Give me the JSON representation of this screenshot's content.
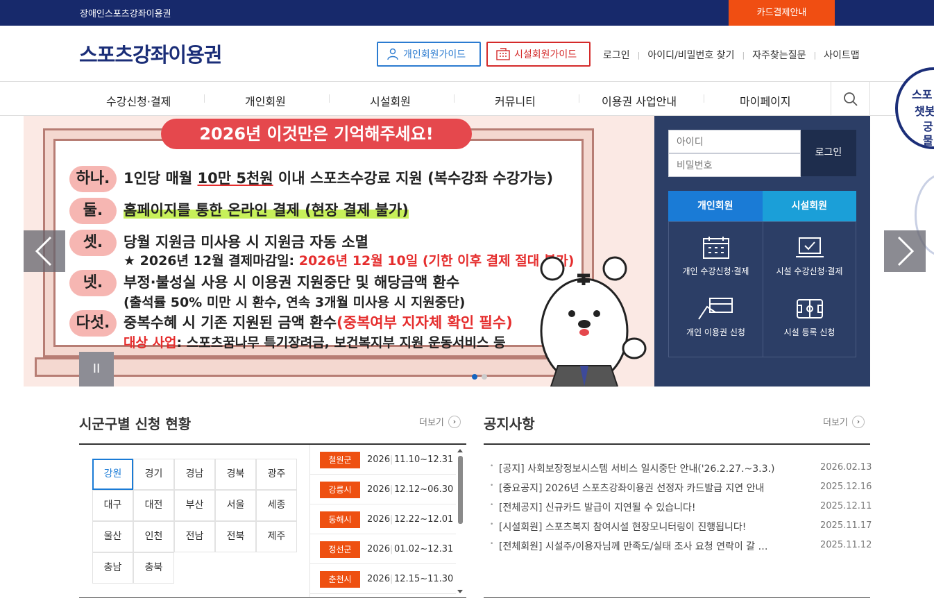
{
  "topbar": {
    "site_name": "장애인스포츠강좌이용권",
    "card_payment": "카드결제안내"
  },
  "header": {
    "logo": "스포츠강좌이용권",
    "guide_personal": "개인회원가이드",
    "guide_facility": "시설회원가이드",
    "utils": [
      "로그인",
      "아이디/비밀번호 찾기",
      "자주찾는질문",
      "사이트맵"
    ]
  },
  "gnb": [
    "수강신청·결제",
    "개인회원",
    "시설회원",
    "커뮤니티",
    "이용권 사업안내",
    "마이페이지"
  ],
  "side_badge": [
    "스포",
    "챗봇",
    "궁",
    "물"
  ],
  "banner": {
    "title": "2026년 이것만은 기억해주세요!",
    "rows": [
      {
        "tag": "하나.",
        "a": "1인당 매월 ",
        "b": "10만 5천원",
        "c": " 이내 스포츠수강료 지원 (복수강좌 수강가능)"
      },
      {
        "tag": "둘.",
        "a": "홈페이지를 통한 온라인 결제 (현장 결제 불가)"
      },
      {
        "tag": "셋.",
        "a": "당월 지원금 미사용 시 지원금 자동 소멸"
      },
      {
        "tag": "넷.",
        "a": "부정·불성실 사용 시 이용권 지원중단 및 해당금액 환수"
      },
      {
        "tag": "다섯.",
        "a": "중복수혜 시 기존 지원된 금액 환수",
        "b": "(중복여부 지자체 확인 필수)"
      }
    ],
    "sub3_a": "★ 2026년 12월 결제마감일: ",
    "sub3_b": "2026년 12월 10일 (기한 이후 결제 절대 불가)",
    "sub4": "(출석률 50% 미만 시 환수, 연속 3개월 미사용 시 지원중단)",
    "sub5_a": "대상 사업",
    "sub5_b": ": 스포츠꿈나무 특기장려금, 보건복지부 지원 운동서비스 등",
    "pause": "II"
  },
  "login": {
    "id_placeholder": "아이디",
    "pw_placeholder": "비밀번호",
    "button": "로그인",
    "tab_personal": "개인회원",
    "tab_facility": "시설회원",
    "services": [
      "개인 수강신청·결제",
      "시설 수강신청·결제",
      "개인 이용권 신청",
      "시설 등록 신청"
    ]
  },
  "regions_section": {
    "title": "시군구별 신청 현황",
    "more": "더보기",
    "regions": [
      "강원",
      "경기",
      "경남",
      "경북",
      "광주",
      "대구",
      "대전",
      "부산",
      "서울",
      "세종",
      "울산",
      "인천",
      "전남",
      "전북",
      "제주",
      "충남",
      "충북"
    ],
    "status": [
      {
        "name": "철원군",
        "year": "2026",
        "period": "11.10~12.31"
      },
      {
        "name": "강릉시",
        "year": "2026",
        "period": "12.12~06.30"
      },
      {
        "name": "동해시",
        "year": "2026",
        "period": "12.22~12.01"
      },
      {
        "name": "정선군",
        "year": "2026",
        "period": "01.02~12.31"
      },
      {
        "name": "춘천시",
        "year": "2026",
        "period": "12.15~11.30"
      }
    ]
  },
  "notice_section": {
    "title": "공지사항",
    "more": "더보기",
    "items": [
      {
        "title": "[공지] 사회보장정보시스템 서비스 일시중단 안내('26.2.27.~3.3.)",
        "date": "2026.02.13"
      },
      {
        "title": "[중요공지] 2026년 스포츠강좌이용권 선정자 카드발급 지연 안내",
        "date": "2025.12.16"
      },
      {
        "title": "[전체공지] 신규카드 발급이 지연될 수 있습니다!",
        "date": "2025.12.11"
      },
      {
        "title": "[시설회원] 스포츠복지 참여시설 현장모니터링이 진행됩니다!",
        "date": "2025.11.17"
      },
      {
        "title": "[전체회원] 시설주/이용자님께 만족도/실태 조사 요청 연락이 갈 …",
        "date": "2025.11.12"
      }
    ]
  },
  "colors": {
    "navy": "#17296b",
    "orange": "#f04e12",
    "blue": "#1a7bd6",
    "red": "#d42a2a"
  }
}
